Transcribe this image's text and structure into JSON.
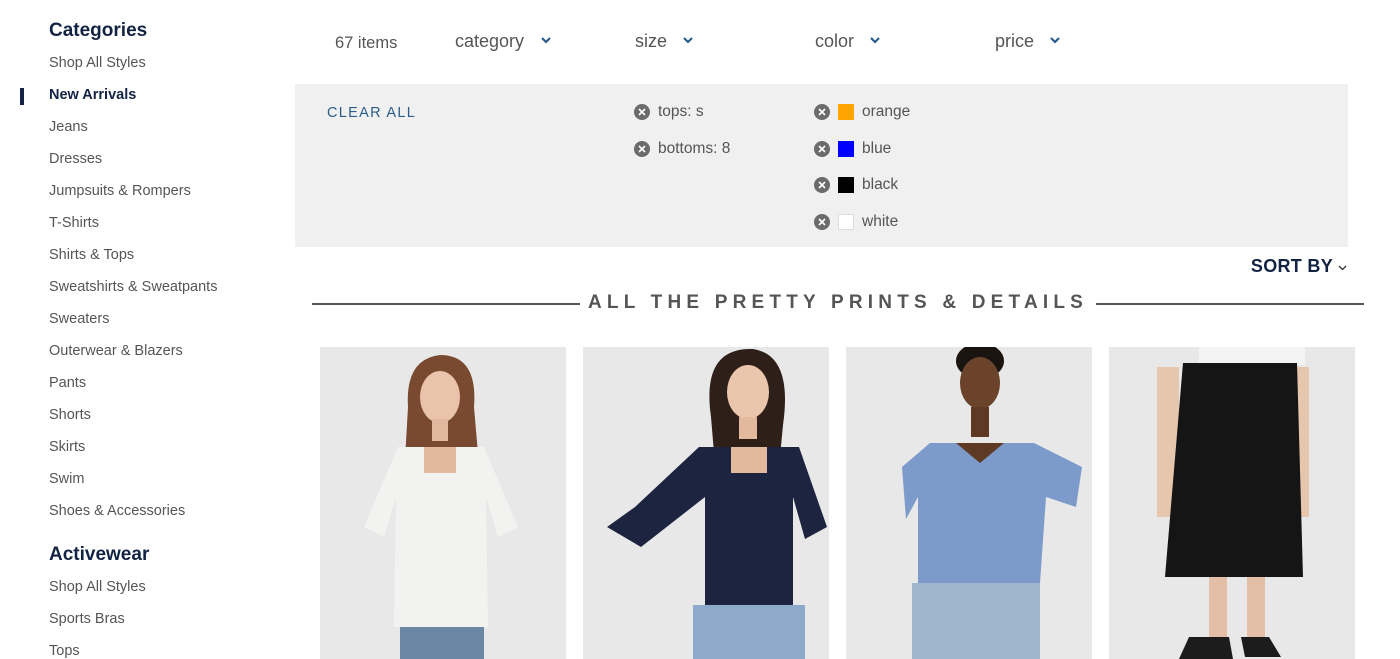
{
  "sidebar": {
    "categories_heading": "Categories",
    "categories": [
      {
        "label": "Shop All Styles",
        "active": false
      },
      {
        "label": "New Arrivals",
        "active": true
      },
      {
        "label": "Jeans",
        "active": false
      },
      {
        "label": "Dresses",
        "active": false
      },
      {
        "label": "Jumpsuits & Rompers",
        "active": false
      },
      {
        "label": "T-Shirts",
        "active": false
      },
      {
        "label": "Shirts & Tops",
        "active": false
      },
      {
        "label": "Sweatshirts & Sweatpants",
        "active": false
      },
      {
        "label": "Sweaters",
        "active": false
      },
      {
        "label": "Outerwear & Blazers",
        "active": false
      },
      {
        "label": "Pants",
        "active": false
      },
      {
        "label": "Shorts",
        "active": false
      },
      {
        "label": "Skirts",
        "active": false
      },
      {
        "label": "Swim",
        "active": false
      },
      {
        "label": "Shoes & Accessories",
        "active": false
      }
    ],
    "activewear_heading": "Activewear",
    "activewear": [
      {
        "label": "Shop All Styles"
      },
      {
        "label": "Sports Bras"
      },
      {
        "label": "Tops"
      }
    ]
  },
  "filters": {
    "item_count": "67 items",
    "dropdowns": [
      {
        "label": "category",
        "icon": "chevron-down-icon"
      },
      {
        "label": "size",
        "icon": "chevron-down-icon"
      },
      {
        "label": "color",
        "icon": "chevron-down-icon"
      },
      {
        "label": "price",
        "icon": "chevron-down-icon"
      }
    ],
    "clear_all": "CLEAR ALL",
    "size_chips": [
      {
        "label": "tops: s",
        "icon": "remove-icon"
      },
      {
        "label": "bottoms: 8",
        "icon": "remove-icon"
      }
    ],
    "color_chips": [
      {
        "label": "orange",
        "swatch": "#ffa500",
        "icon": "remove-icon"
      },
      {
        "label": "blue",
        "swatch": "#0000ff",
        "icon": "remove-icon"
      },
      {
        "label": "black",
        "swatch": "#000000",
        "icon": "remove-icon"
      },
      {
        "label": "white",
        "swatch": "#ffffff",
        "icon": "remove-icon"
      }
    ]
  },
  "sort": {
    "label": "SORT BY",
    "icon": "chevron-down-icon"
  },
  "section": {
    "title": "ALL THE PRETTY PRINTS & DETAILS"
  },
  "products": [
    {
      "name": "white eyelet square-neck top with jeans",
      "top_color": "#f2f2f0",
      "bottom_color": "#6c87a3",
      "hair_color": "#7a4a30"
    },
    {
      "name": "navy eyelet square-neck top with jeans",
      "top_color": "#1c2440",
      "bottom_color": "#8eaacb",
      "hair_color": "#2e2019"
    },
    {
      "name": "light blue eyelet flutter-sleeve top with jeans",
      "top_color": "#7c9bcb",
      "bottom_color": "#9fb5cc",
      "hair_color": "#1a1410"
    },
    {
      "name": "black eyelet midi skirt",
      "top_color": "#f4f4f4",
      "bottom_color": "#151515",
      "hair_color": ""
    }
  ],
  "colors": {
    "navy": "#122344",
    "link_blue": "#2b5d8c",
    "panel_gray": "#f0f0f0"
  }
}
